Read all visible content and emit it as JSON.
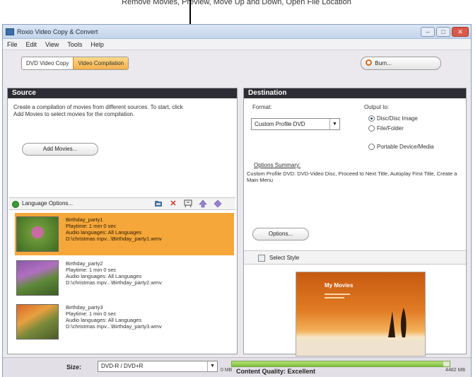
{
  "caption": "Remove Movies, Preview, Move Up and Down, Open File Location",
  "window": {
    "title": "Roxio Video Copy & Convert",
    "controls": [
      "–",
      "□",
      "✕"
    ]
  },
  "menu": [
    "File",
    "Edit",
    "View",
    "Tools",
    "Help"
  ],
  "tabs": [
    {
      "label": "DVD Video Copy",
      "active": false
    },
    {
      "label": "Video Compilation",
      "active": true
    }
  ],
  "burn_label": "Burn...",
  "source": {
    "header": "Source",
    "description": "Create a compilation of movies from different sources. To start, click Add Movies to select movies for the compilation.",
    "add_movies_label": "Add Movies...",
    "language_options_label": "Language Options...",
    "movies": [
      {
        "name": "Birthday_party1",
        "playtime": "Playtime: 1 min 0 sec",
        "audio": "Audio languages: All Languages",
        "path": "D:\\christmas mpv...\\Birthday_party1.wmv",
        "selected": true
      },
      {
        "name": "Birthday_party2",
        "playtime": "Playtime: 1 min 0 sec",
        "audio": "Audio languages: All Languages",
        "path": "D:\\christmas mpv...\\Birthday_party2.wmv",
        "selected": false
      },
      {
        "name": "Birthday_party3",
        "playtime": "Playtime: 1 min 0 sec",
        "audio": "Audio languages: All Languages",
        "path": "D:\\christmas mpv...\\Birthday_party3.wmv",
        "selected": false
      }
    ]
  },
  "destination": {
    "header": "Destination",
    "format_label": "Format:",
    "format_value": "Custom Profile DVD",
    "output_label": "Output to:",
    "output_options": [
      {
        "label": "Disc/Disc Image",
        "selected": true
      },
      {
        "label": "File/Folder",
        "selected": false
      },
      {
        "label": "Portable Device/Media",
        "selected": false
      }
    ],
    "summary_link": "Options Summary:",
    "summary_text": "Custom Profile DVD: DVD-Video Disc, Proceed to Next Title, Autoplay First Title, Create a Main Menu",
    "options_label": "Options...",
    "select_style_label": "Select Style",
    "preview_title": "My Movies"
  },
  "status": {
    "size_label": "Size:",
    "size_value": "DVD-R / DVD+R",
    "min_label": "0 MB",
    "quality_text": "Content Quality: Excellent",
    "max_label": "4482 MB",
    "fill_fraction": 0.97
  }
}
